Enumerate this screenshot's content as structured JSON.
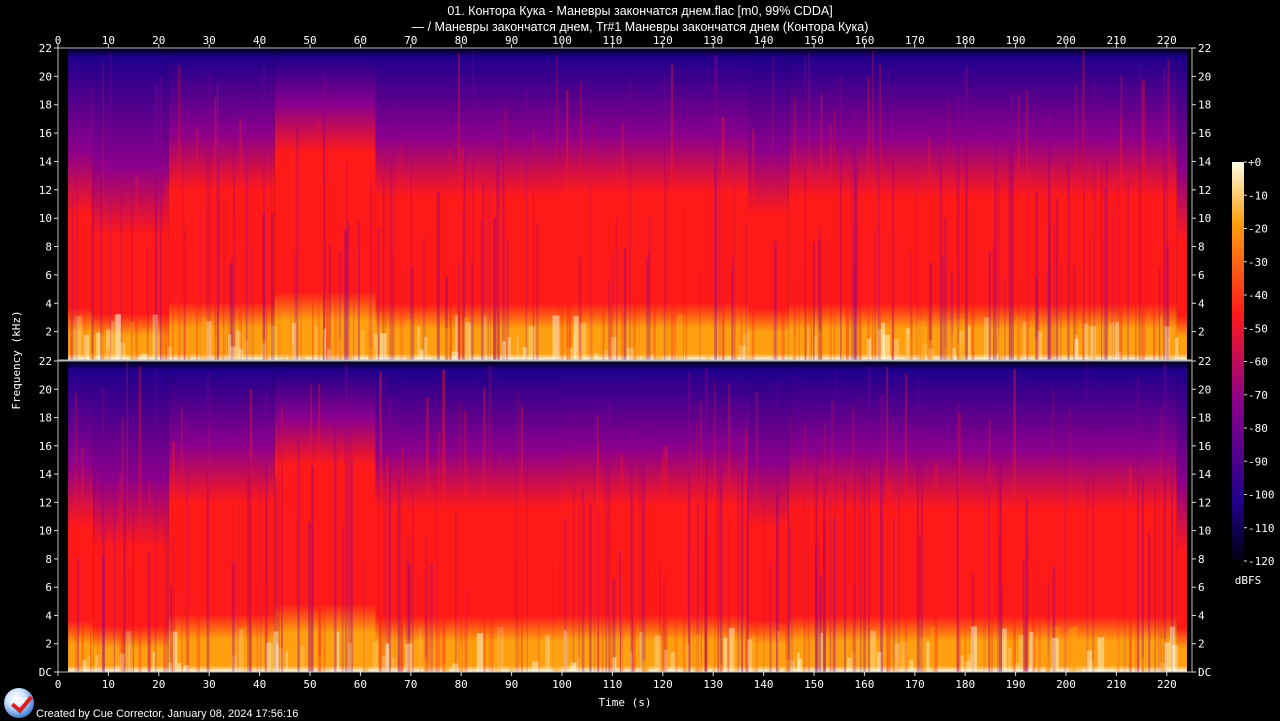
{
  "header": {
    "title": "01. Контора Кука - Маневры закончатся днем.flac [m0, 99% CDDA]",
    "subtitle": "— / Маневры закончатся днем, Tr#1 Маневры закончатся днем (Контора Кука)"
  },
  "chart_data": {
    "type": "heatmap",
    "title": "01. Контора Кука - Маневры закончатся днем.flac [m0, 99% CDDA]",
    "subtitle": "— / Маневры закончатся днем, Tr#1 Маневры закончатся днем (Контора Кука)",
    "xlabel": "Time (s)",
    "ylabel": "Frequency (kHz)",
    "xlim": [
      0,
      225
    ],
    "ylim": [
      0,
      22
    ],
    "x_ticks": [
      0,
      10,
      20,
      30,
      40,
      50,
      60,
      70,
      80,
      90,
      100,
      110,
      120,
      130,
      140,
      150,
      160,
      170,
      180,
      190,
      200,
      210,
      220
    ],
    "y_ticks_upper": [
      "22",
      "20",
      "18",
      "16",
      "14",
      "12",
      "10",
      "8",
      "6",
      "4",
      "2"
    ],
    "y_ticks_lower": [
      "22",
      "20",
      "18",
      "16",
      "14",
      "12",
      "10",
      "8",
      "6",
      "4",
      "2",
      "DC"
    ],
    "channels": 2,
    "track_duration_s": 224,
    "colorbar": {
      "label": "dBFS",
      "ticks": [
        "+0",
        "-10",
        "-20",
        "-30",
        "-40",
        "-50",
        "-60",
        "-70",
        "-80",
        "-90",
        "-100",
        "-110",
        "-120"
      ],
      "range": [
        -120,
        0
      ]
    },
    "sections": [
      {
        "start": 2,
        "end": 7,
        "level": 0.3
      },
      {
        "start": 7,
        "end": 22,
        "level": 0.18
      },
      {
        "start": 22,
        "end": 43,
        "level": 0.44
      },
      {
        "start": 43,
        "end": 63,
        "level": 0.66
      },
      {
        "start": 63,
        "end": 100,
        "level": 0.4
      },
      {
        "start": 100,
        "end": 137,
        "level": 0.42
      },
      {
        "start": 137,
        "end": 145,
        "level": 0.3
      },
      {
        "start": 145,
        "end": 222,
        "level": 0.4
      },
      {
        "start": 222,
        "end": 224,
        "level": 0.15
      }
    ],
    "colors": {
      "low": "#000010",
      "mid_low": "#20008c",
      "mid": "#8c008c",
      "mid_high": "#ff1a1a",
      "high": "#ffa010",
      "peak": "#ffffe6"
    }
  },
  "footer": {
    "credit": "Created by Cue Corrector, January 08, 2024 17:56:16",
    "logo_text": "CUE"
  }
}
